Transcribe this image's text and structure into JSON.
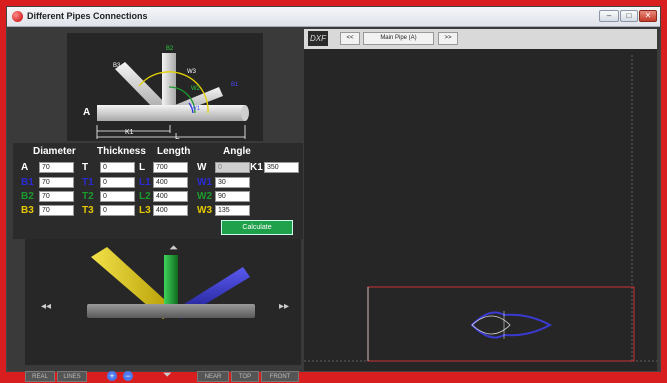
{
  "window": {
    "title": "Different Pipes Connections"
  },
  "diagram": {
    "labels": {
      "A": "A",
      "K1": "K1",
      "L": "L",
      "B1": "B1",
      "B2": "B2",
      "B3": "B3",
      "W1": "W1",
      "W2": "W2",
      "W3": "W3"
    }
  },
  "params": {
    "headers": {
      "diameter": "Diameter",
      "thickness": "Thickness",
      "length": "Length",
      "angle": "Angle"
    },
    "rows": {
      "A": {
        "label": "A",
        "diameter": "70",
        "t_label": "T",
        "thickness": "0",
        "l_label": "L",
        "length": "700",
        "w_label": "W",
        "angle": "0"
      },
      "B1": {
        "label": "B1",
        "diameter": "70",
        "t_label": "T1",
        "thickness": "0",
        "l_label": "L1",
        "length": "400",
        "w_label": "W1",
        "angle": "30"
      },
      "B2": {
        "label": "B2",
        "diameter": "70",
        "t_label": "T2",
        "thickness": "0",
        "l_label": "L2",
        "length": "400",
        "w_label": "W2",
        "angle": "90"
      },
      "B3": {
        "label": "B3",
        "diameter": "70",
        "t_label": "T3",
        "thickness": "0",
        "l_label": "L3",
        "length": "400",
        "w_label": "W3",
        "angle": "135"
      }
    },
    "k1_label": "K1",
    "k1_value": "350",
    "calculate_label": "Calculate"
  },
  "viewer": {
    "buttons": {
      "real": "REAL",
      "lines": "LINES",
      "near": "NEAR",
      "top": "TOP",
      "front": "FRONT"
    }
  },
  "dxf": {
    "logo": "DXF",
    "prev_label": "<<",
    "pipe_label": "Main Pipe (A)",
    "next_label": ">>"
  },
  "colors": {
    "b1": "#2b2bd6",
    "b2": "#1d9a2e",
    "b3": "#e5c800",
    "calc": "#1fa04a",
    "frame": "#d81e1e"
  }
}
